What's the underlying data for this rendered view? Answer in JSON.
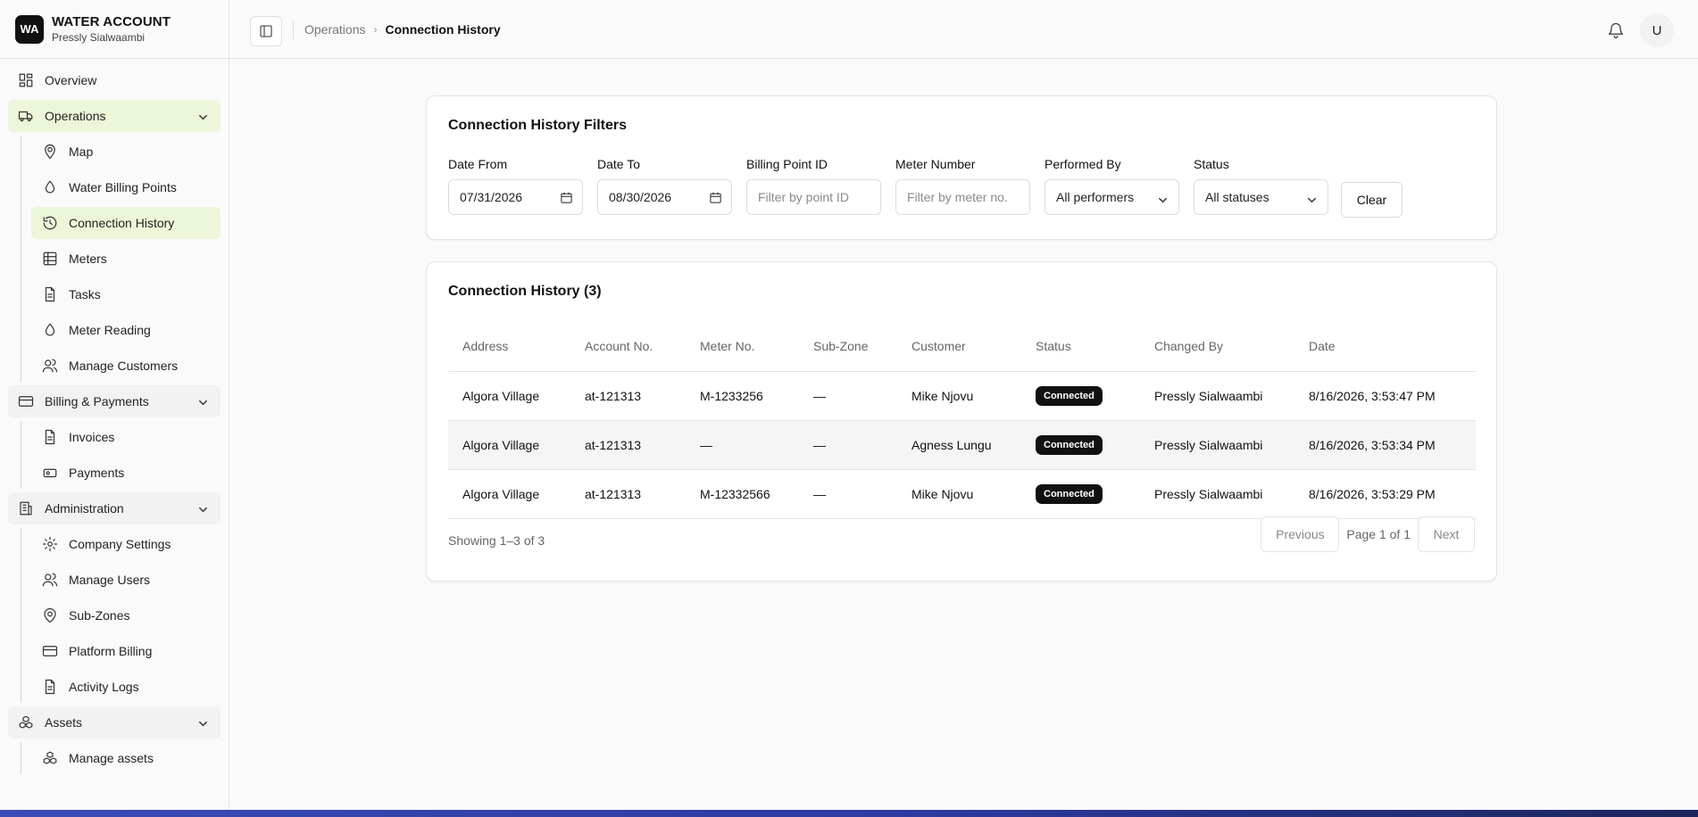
{
  "brand": {
    "logo": "WA",
    "title": "WATER ACCOUNT",
    "subtitle": "Pressly Sialwaambi"
  },
  "sidebar": {
    "overview": "Overview",
    "operations": {
      "label": "Operations",
      "items": [
        "Map",
        "Water Billing Points",
        "Connection History",
        "Meters",
        "Tasks",
        "Meter Reading",
        "Manage Customers"
      ]
    },
    "billing": {
      "label": "Billing & Payments",
      "items": [
        "Invoices",
        "Payments"
      ]
    },
    "administration": {
      "label": "Administration",
      "items": [
        "Company Settings",
        "Manage Users",
        "Sub-Zones",
        "Platform Billing",
        "Activity Logs"
      ]
    },
    "assets": {
      "label": "Assets",
      "items": [
        "Manage assets"
      ]
    }
  },
  "breadcrumb": {
    "parent": "Operations",
    "separator": "›",
    "current": "Connection History"
  },
  "user": {
    "avatar_initial": "U"
  },
  "filters": {
    "title": "Connection History Filters",
    "date_from": {
      "label": "Date From",
      "value": "07/31/2026"
    },
    "date_to": {
      "label": "Date To",
      "value": "08/30/2026"
    },
    "billing_point": {
      "label": "Billing Point ID",
      "placeholder": "Filter by point ID"
    },
    "meter_number": {
      "label": "Meter Number",
      "placeholder": "Filter by meter no."
    },
    "performed_by": {
      "label": "Performed By",
      "value": "All performers"
    },
    "status": {
      "label": "Status",
      "value": "All statuses"
    },
    "clear_label": "Clear"
  },
  "history": {
    "title": "Connection History (3)",
    "columns": [
      "Address",
      "Account No.",
      "Meter No.",
      "Sub-Zone",
      "Customer",
      "Status",
      "Changed By",
      "Date"
    ],
    "rows": [
      {
        "address": "Algora Village",
        "account": "at-121313",
        "meter": "M-1233256",
        "subzone": "—",
        "customer": "Mike Njovu",
        "status": "Connected",
        "changed_by": "Pressly Sialwaambi",
        "date": "8/16/2026, 3:53:47 PM"
      },
      {
        "address": "Algora Village",
        "account": "at-121313",
        "meter": "—",
        "subzone": "—",
        "customer": "Agness Lungu",
        "status": "Connected",
        "changed_by": "Pressly Sialwaambi",
        "date": "8/16/2026, 3:53:34 PM"
      },
      {
        "address": "Algora Village",
        "account": "at-121313",
        "meter": "M-12332566",
        "subzone": "—",
        "customer": "Mike Njovu",
        "status": "Connected",
        "changed_by": "Pressly Sialwaambi",
        "date": "8/16/2026, 3:53:29 PM"
      }
    ],
    "showing": "Showing 1–3 of 3",
    "pagination": {
      "previous": "Previous",
      "page_info": "Page 1 of 1",
      "next": "Next"
    }
  },
  "colors": {
    "active_bg": "#ecf6d8",
    "badge_bg": "#111111",
    "taskbar": "#2d3a9e"
  }
}
